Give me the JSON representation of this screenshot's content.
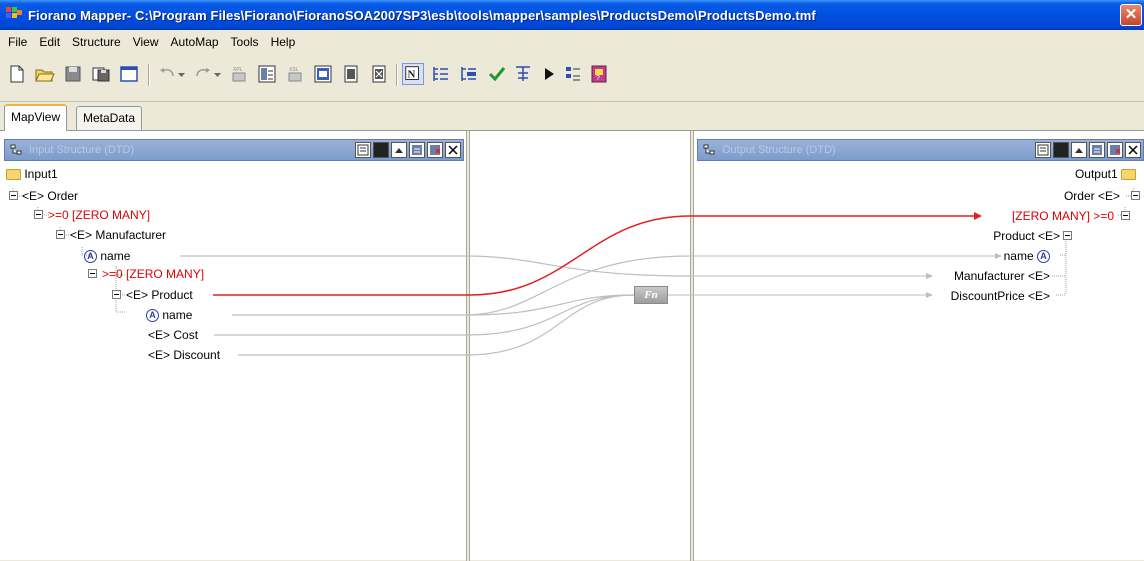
{
  "window": {
    "title": "Fiorano Mapper- C:\\Program Files\\Fiorano\\FioranoSOA2007SP3\\esb\\tools\\mapper\\samples\\ProductsDemo\\ProductsDemo.tmf",
    "close_label": "✕"
  },
  "menu": [
    "File",
    "Edit",
    "Structure",
    "View",
    "AutoMap",
    "Tools",
    "Help"
  ],
  "tabs": [
    "MapView",
    "MetaData"
  ],
  "input_panel": {
    "title": "Input Structure (DTD)",
    "root": "Input1",
    "nodes": {
      "order": "<E> Order",
      "zero_many_1": ">=0 [ZERO MANY]",
      "manufacturer": "<E> Manufacturer",
      "name": "name",
      "zero_many_2": ">=0 [ZERO MANY]",
      "product": "<E> Product",
      "product_name": "name",
      "cost": "<E> Cost",
      "discount": "<E> Discount"
    }
  },
  "output_panel": {
    "title": "Output Structure (DTD)",
    "root": "Output1",
    "nodes": {
      "order": "Order <E>",
      "zero_many": "[ZERO MANY] >=0",
      "product": "Product <E>",
      "name": "name",
      "manufacturer": "Manufacturer <E>",
      "discount_price": "DiscountPrice <E>"
    }
  },
  "function_box": "Fn",
  "attr_glyph": "A",
  "colors": {
    "mapping_active": "#E02020",
    "mapping_inactive": "#BDBDBD",
    "title_bar": "#0050E0"
  }
}
